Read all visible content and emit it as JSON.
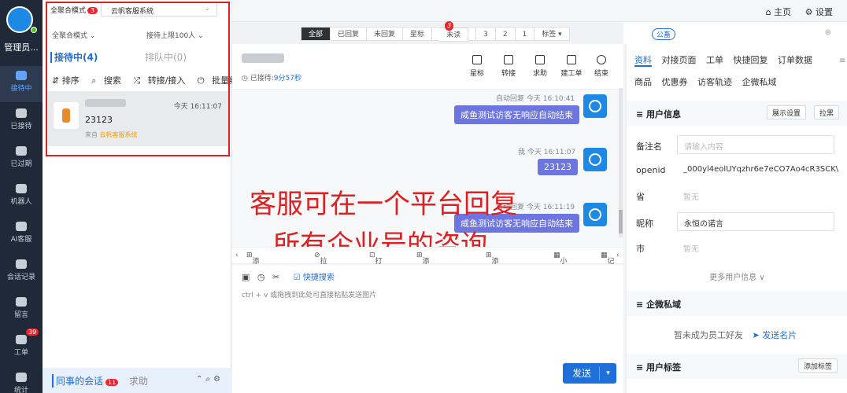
{
  "nav": {
    "user_name": "管理员...",
    "items": [
      {
        "label": "接待中",
        "icon": "chat-bubble-icon",
        "active": true
      },
      {
        "label": "已接待",
        "icon": "check-circle-icon"
      },
      {
        "label": "已过期",
        "icon": "expired-icon"
      },
      {
        "label": "机器人",
        "icon": "robot-icon"
      },
      {
        "label": "AI客服",
        "icon": "ai-chat-icon"
      },
      {
        "label": "会话记录",
        "icon": "record-icon"
      },
      {
        "label": "留言",
        "icon": "message-icon"
      },
      {
        "label": "工单",
        "icon": "ticket-icon",
        "badge": "39"
      },
      {
        "label": "统计",
        "icon": "stats-icon"
      }
    ]
  },
  "topbar": {
    "home": "⌂ 主页",
    "settings": "⚙ 设置"
  },
  "session": {
    "mode_label": "全聚合模式",
    "mode_badge": "3",
    "account_select": "云帆客服系统",
    "mode_dropdown": "全聚合模式",
    "limit_dropdown": "接待上限100人",
    "tab_active": "接待中(4)",
    "tab_queue": "排队中(0)",
    "actions": [
      "排序",
      "搜索",
      "转接/接入",
      "批量结束"
    ],
    "card": {
      "time": "今天 16:11:07",
      "message": "23123",
      "from_prefix": "来自",
      "from_source": "云帆客服系统"
    },
    "footer": {
      "colleagues": "同事的会话",
      "colleagues_badge": "11",
      "help": "求助"
    }
  },
  "filters": {
    "items": [
      "全部",
      "已回复",
      "未回复",
      "星标",
      "未读",
      "3",
      "2",
      "1",
      "标签 ▾"
    ],
    "unread_badge": "3"
  },
  "chat": {
    "wait_label": "已接待:",
    "wait_time": "9分57秒",
    "header_buttons": [
      "星标",
      "转接",
      "求助",
      "建工单",
      "结束"
    ],
    "messages": [
      {
        "meta": "自动回复  今天 16:10:41",
        "text": "咸鱼测试访客无响应自动结束"
      },
      {
        "meta": "我  今天 16:11:07",
        "text": "23123"
      },
      {
        "meta": "自动回复  今天 16:11:19",
        "text": "咸鱼测试访客无响应自动结束"
      }
    ],
    "quick_bar": [
      "添加快捷回复",
      "拉黑名单",
      "打标签",
      "添加服务记录",
      "添加跟进记录",
      "小客服",
      "记"
    ],
    "quick_search": "快捷搜索",
    "input_placeholder": "ctrl + v 或拖拽到此处可直接粘贴发送图片",
    "send": "发送"
  },
  "overlay": {
    "line1": "客服可在一个平台回复",
    "line2": "所有企业号的咨询"
  },
  "right": {
    "tag": "公畜",
    "tabs_row1": [
      "资料",
      "对接页面",
      "工单",
      "快捷回复",
      "订单数据"
    ],
    "tabs_row2": [
      "商品",
      "优惠券",
      "访客轨迹",
      "企微私域"
    ],
    "user_info_title": "用户信息",
    "display_settings": "展示设置",
    "pull_black": "拉黑",
    "fields": [
      {
        "key": "备注名",
        "value": "请输入内容",
        "type": "input-placeholder"
      },
      {
        "key": "openid",
        "value": "_000yl4eolUYqzhr6e7eCO7Ao4cR3SCK\\",
        "type": "text"
      },
      {
        "key": "省",
        "value": "暂无",
        "type": "gray"
      },
      {
        "key": "昵称",
        "value": "永恒の诺言",
        "type": "input"
      },
      {
        "key": "市",
        "value": "暂无",
        "type": "gray"
      }
    ],
    "more_info": "更多用户信息 ∨",
    "wecom_title": "企微私域",
    "not_friend": "暂未成为员工好友",
    "send_card": "发送名片",
    "tags_title": "用户标签",
    "add_tag": "添加标签"
  }
}
